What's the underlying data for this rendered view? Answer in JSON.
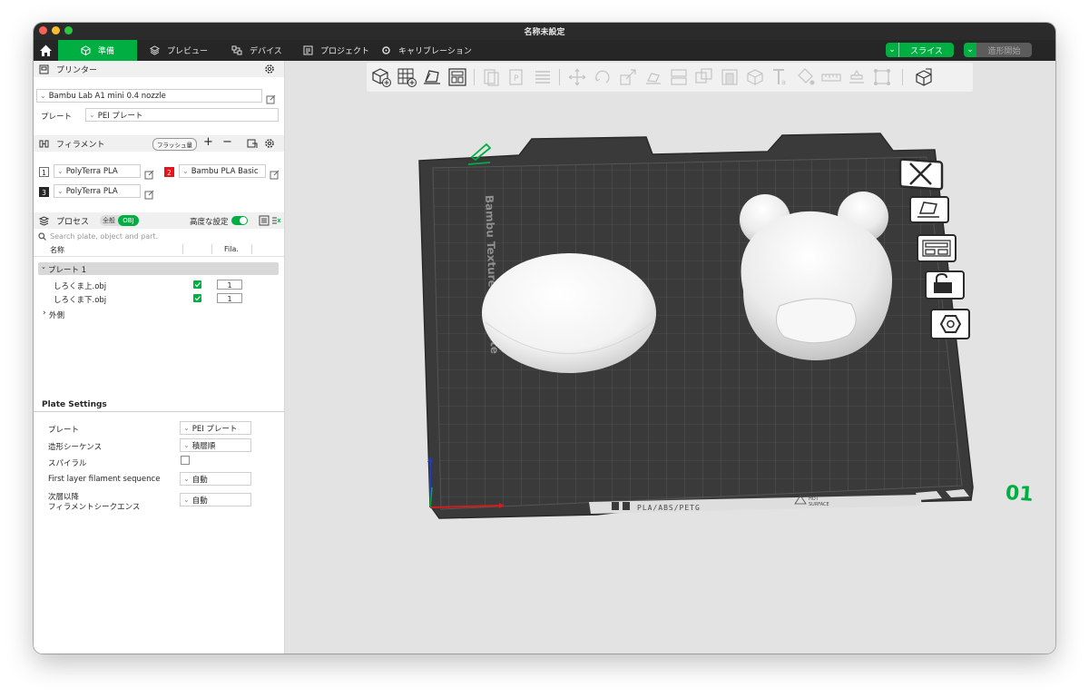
{
  "window": {
    "title": "名称未設定"
  },
  "nav": {
    "tabs": [
      {
        "label": "準備",
        "active": true,
        "icon": "cube-icon"
      },
      {
        "label": "プレビュー",
        "icon": "layers-icon"
      },
      {
        "label": "デバイス",
        "icon": "device-icon"
      },
      {
        "label": "プロジェクト",
        "icon": "project-icon"
      },
      {
        "label": "キャリブレーション",
        "icon": "calibration-icon"
      }
    ],
    "slice_label": "スライス",
    "print_label": "造形開始"
  },
  "printer": {
    "section_title": "プリンター",
    "model": "Bambu Lab A1 mini 0.4 nozzle",
    "plate_label": "プレート",
    "plate_value": "PEI プレート"
  },
  "filament": {
    "section_title": "フィラメント",
    "flush_label": "フラッシュ量",
    "items": [
      {
        "num": "1",
        "name": "PolyTerra PLA",
        "color": "#ffffff"
      },
      {
        "num": "2",
        "name": "Bambu PLA Basic",
        "color": "#e8141c"
      },
      {
        "num": "3",
        "name": "PolyTerra PLA",
        "color": "#262626"
      }
    ]
  },
  "process": {
    "section_title": "プロセス",
    "toggle_global": "全般",
    "toggle_obj": "OBJ",
    "advanced_label": "高度な設定",
    "search_placeholder": "Search plate, object and part."
  },
  "tree": {
    "col_name": "名称",
    "col_fila": "Fila.",
    "plate": "プレート 1",
    "objects": [
      {
        "name": "しろくま上.obj",
        "fila": "1"
      },
      {
        "name": "しろくま下.obj",
        "fila": "1"
      }
    ],
    "outer": "外側"
  },
  "plate_settings": {
    "title": "Plate Settings",
    "rows": [
      {
        "label": "プレート",
        "value": "PEI プレート"
      },
      {
        "label": "造形シーケンス",
        "value": "積層順"
      },
      {
        "label": "スパイラル",
        "value": ""
      },
      {
        "label": "First layer filament sequence",
        "value": "自動"
      },
      {
        "label_line1": "次層以降",
        "label_line2": "フィラメントシークエンス",
        "value": "自動"
      }
    ]
  },
  "bed": {
    "side_text": "Bambu Textured PEI Plate",
    "bottom_text": "PLA/ABS/PETG",
    "hot_line1": "HOT",
    "hot_line2": "SURFACE",
    "plate_number": "01"
  },
  "colors": {
    "accent": "#00ae42",
    "dark": "#262626"
  }
}
